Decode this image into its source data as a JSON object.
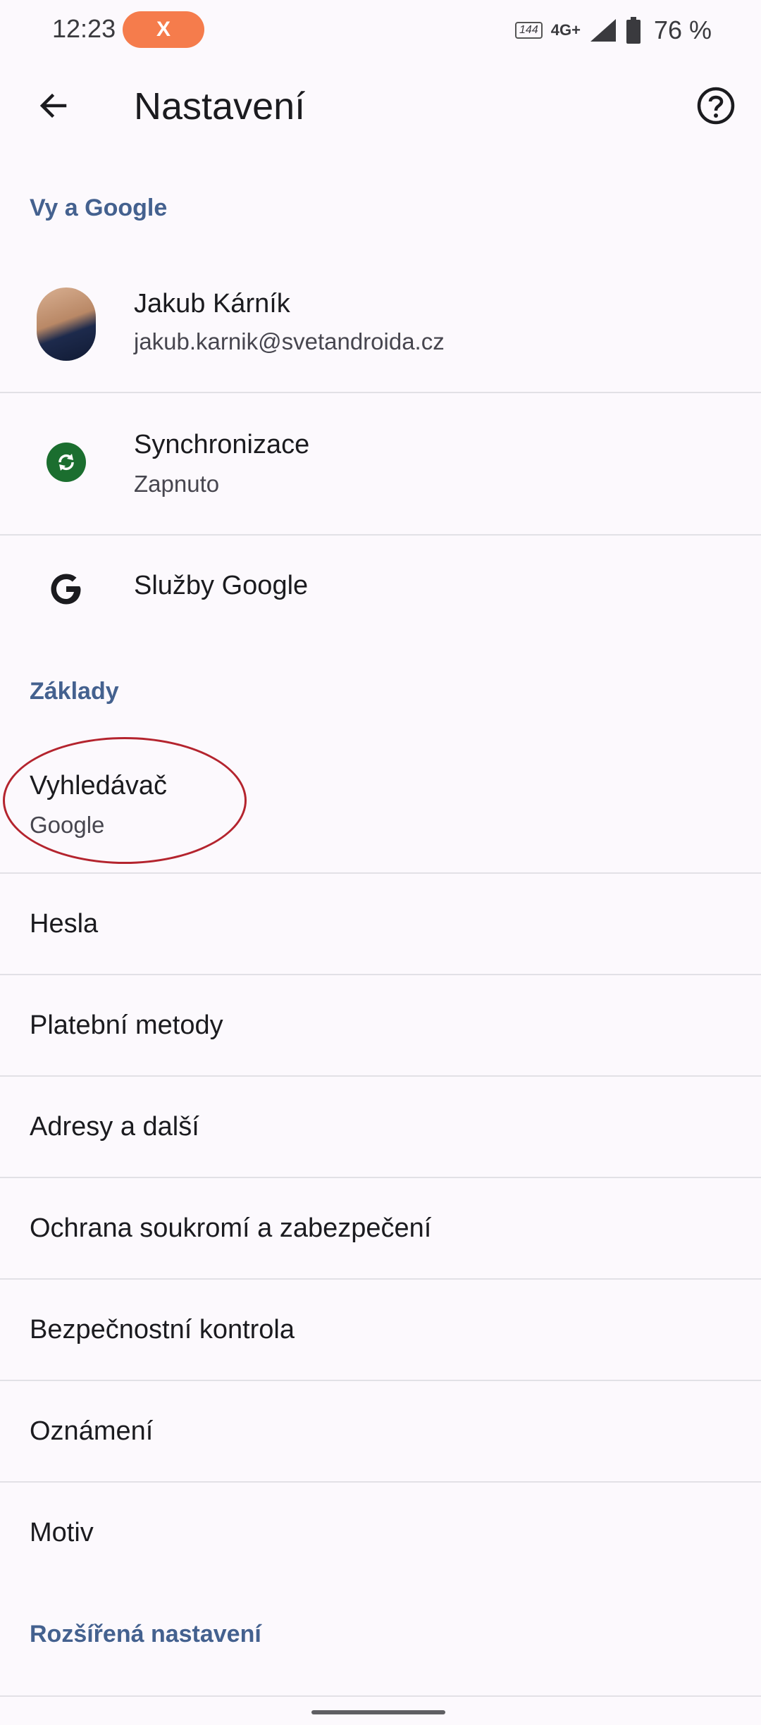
{
  "status": {
    "time": "12:23",
    "pill_label": "X",
    "refresh_rate": "144",
    "network": "4G+",
    "battery": "76 %"
  },
  "app_bar": {
    "title": "Nastavení"
  },
  "sections": {
    "you_and_google": "Vy a Google",
    "basics": "Základy",
    "advanced": "Rozšířená nastavení"
  },
  "account": {
    "name": "Jakub Kárník",
    "email": "jakub.karnik@svetandroida.cz"
  },
  "sync": {
    "title": "Synchronizace",
    "status": "Zapnuto"
  },
  "google_services": {
    "title": "Služby Google"
  },
  "search_engine": {
    "title": "Vyhledávač",
    "value": "Google"
  },
  "items": [
    "Hesla",
    "Platební metody",
    "Adresy a další",
    "Ochrana soukromí a zabezpečení",
    "Bezpečnostní kontrola",
    "Oznámení",
    "Motiv"
  ],
  "colors": {
    "accent": "#44618f",
    "background": "#fcf9fd",
    "sync_icon": "#1b6e2f",
    "highlight": "#b4242e",
    "status_pill": "#f57c4c"
  },
  "icons": {
    "back": "arrow-left-icon",
    "help": "help-circle-icon",
    "sync": "sync-icon",
    "google": "google-g-icon"
  }
}
